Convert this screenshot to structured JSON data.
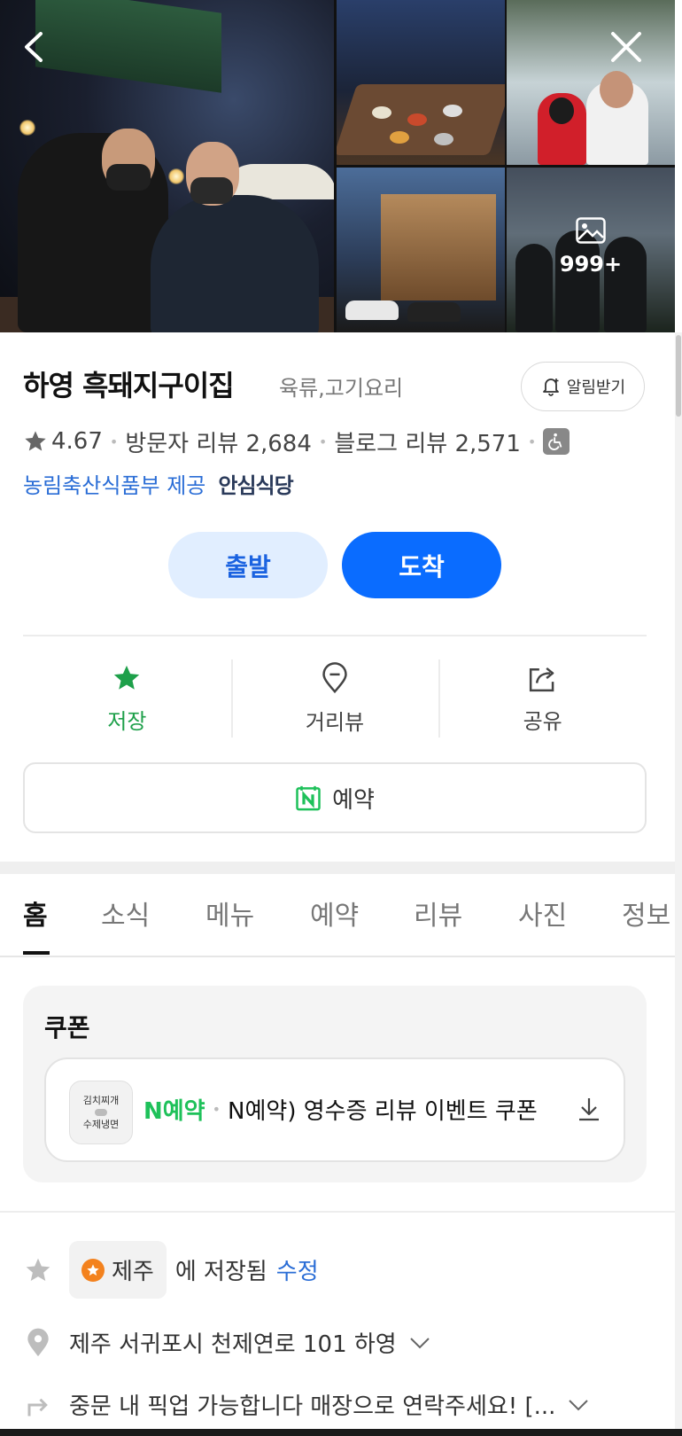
{
  "gallery": {
    "more_count": "999+"
  },
  "place": {
    "name": "하영 흑돼지구이집",
    "category": "육류,고기요리",
    "notify_label": "알림받기",
    "rating": "4.67",
    "visitor_reviews": "방문자 리뷰 2,684",
    "blog_reviews": "블로그 리뷰 2,571",
    "cert_provider": "농림축산식품부 제공",
    "cert_badge": "안심식당"
  },
  "route": {
    "depart_label": "출발",
    "arrive_label": "도착"
  },
  "actions": {
    "save_label": "저장",
    "streetview_label": "거리뷰",
    "share_label": "공유"
  },
  "reserve": {
    "label": "예약"
  },
  "tabs": [
    "홈",
    "소식",
    "메뉴",
    "예약",
    "리뷰",
    "사진",
    "정보"
  ],
  "coupon": {
    "title": "쿠폰",
    "logo_line1": "김치찌개",
    "logo_line2": "수제냉면",
    "brand_n": "N",
    "brand_text": "예약",
    "text": "N예약) 영수증 리뷰 이벤트 쿠폰"
  },
  "info": {
    "saved_folder": "제주",
    "saved_suffix": "에 저장됨",
    "edit_label": "수정",
    "address": "제주 서귀포시 천제연로 101 하영",
    "directions": "중문 내 픽업 가능합니다 매장으로 연락주세요! [..."
  },
  "colors": {
    "accent_blue": "#0a6cff",
    "save_green": "#1ea04a",
    "link_blue": "#2a6dd6"
  }
}
